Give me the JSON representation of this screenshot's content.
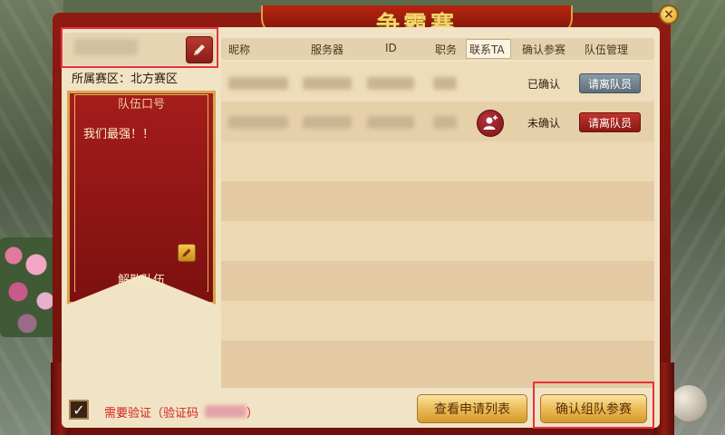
{
  "window": {
    "title": "争霸赛"
  },
  "team": {
    "zone_label": "所属赛区：北方赛区",
    "slogan_title": "队伍口号",
    "slogan_text": "我们最强！！",
    "disband_label": "解散队伍"
  },
  "table": {
    "columns": [
      "昵称",
      "服务器",
      "ID",
      "职务",
      "联系TA",
      "确认参赛",
      "队伍管理"
    ],
    "rows": [
      {
        "status": "已确认",
        "action": "请离队员",
        "action_style": "grey",
        "has_contact": false
      },
      {
        "status": "未确认",
        "action": "请离队员",
        "action_style": "red",
        "has_contact": true
      }
    ]
  },
  "footer": {
    "verify_checked": true,
    "verify_label": "需要验证（验证码",
    "verify_close": "）",
    "view_applications": "查看申请列表",
    "confirm_team": "确认组队参赛"
  },
  "colors": {
    "frame_red": "#8f1a12",
    "parchment": "#f1e3c6",
    "gold": "#e9b850",
    "alert_red": "#d3211b",
    "highlight": "#e8313a"
  }
}
